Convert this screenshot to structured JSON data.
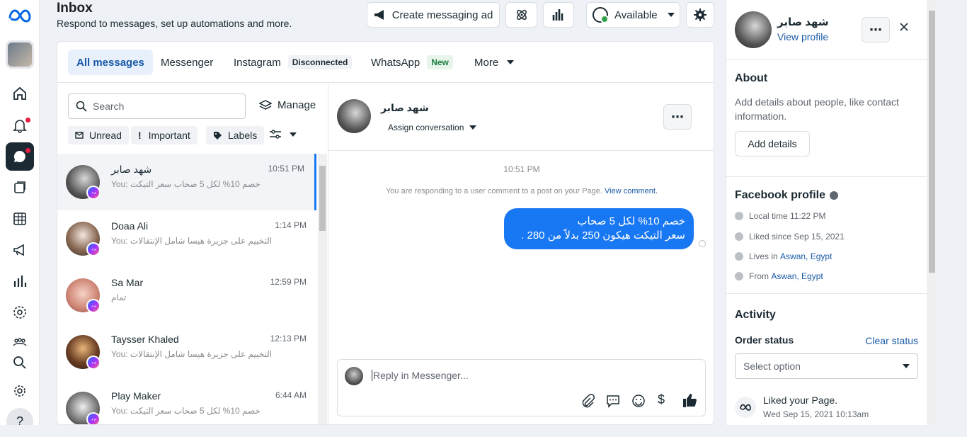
{
  "header": {
    "title": "Inbox",
    "subtitle": "Respond to messages, set up automations and more.",
    "create_ad_label": "Create messaging ad",
    "status_label": "Available"
  },
  "tabs": [
    {
      "label": "All messages"
    },
    {
      "label": "Messenger"
    },
    {
      "label": "Instagram",
      "badge": "Disconnected"
    },
    {
      "label": "WhatsApp",
      "badge": "New"
    },
    {
      "label": "More"
    }
  ],
  "list": {
    "search_placeholder": "Search",
    "manage_label": "Manage",
    "filters": [
      "Unread",
      "Important",
      "Labels"
    ],
    "conversations": [
      {
        "name": "شهد صابر",
        "time": "10:51 PM",
        "preview": "You: خصم 10% لكل 5 صحاب سعر التيكت"
      },
      {
        "name": "Doaa Ali",
        "time": "1:14 PM",
        "preview": "You: التخييم على جزيرة هيسا شامل الإنتقالات"
      },
      {
        "name": "Sa Mar",
        "time": "12:59 PM",
        "preview": "تمام"
      },
      {
        "name": "Taysser Khaled",
        "time": "12:13 PM",
        "preview": "You: التخييم على جزيرة هيسا شامل الإنتقالات"
      },
      {
        "name": "Play Maker",
        "time": "6:44 AM",
        "preview": "You: خصم 10% لكل 5 صحاب سعر التيكت"
      }
    ]
  },
  "chat": {
    "contact_name": "شهد صابر",
    "assign_label": "Assign conversation",
    "timestamp": "10:51 PM",
    "notice": "You are responding to a user comment to a post on your Page.",
    "notice_link": "View comment.",
    "message_line1": "خصم 10% لكل 5 صحاب",
    "message_line2": "سعر التيكت هيكون 250 بدلاً من 280 .",
    "reply_placeholder": "Reply in Messenger..."
  },
  "profile": {
    "name": "شهد صابر",
    "view_profile": "View profile",
    "about_title": "About",
    "about_text": "Add details about people, like contact information.",
    "add_details_label": "Add details",
    "fb_profile_title": "Facebook profile",
    "local_time": "Local time 11:22 PM",
    "liked_since": "Liked since Sep 15, 2021",
    "lives_in_prefix": "Lives in ",
    "lives_in": "Aswan, Egypt",
    "from_prefix": "From ",
    "from": "Aswan, Egypt",
    "activity_title": "Activity",
    "order_status_title": "Order status",
    "clear_status": "Clear status",
    "select_option": "Select option",
    "activity_event": "Liked your Page.",
    "activity_time": "Wed Sep 15, 2021 10:13am"
  },
  "colors": {
    "accent": "#1877f2",
    "nav_dark": "#1c2b33",
    "available_green": "#31a24c"
  }
}
